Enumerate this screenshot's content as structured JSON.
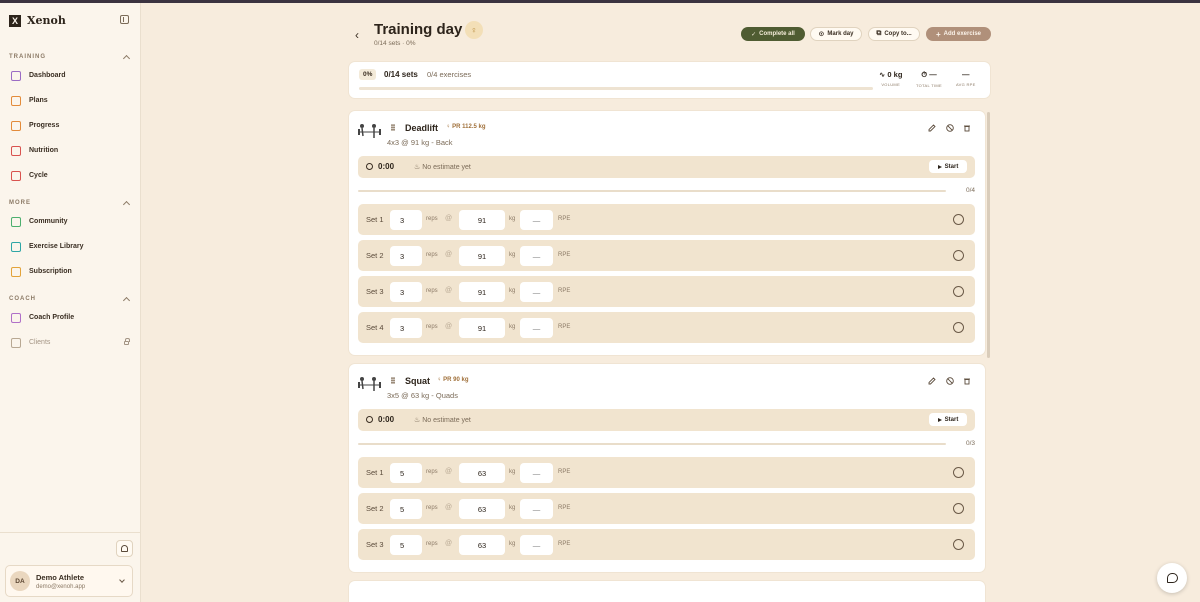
{
  "app": {
    "name": "Xenoh",
    "logo_letter": "X"
  },
  "sidebar": {
    "sections": [
      {
        "title": "TRAINING",
        "items": [
          {
            "label": "Dashboard",
            "icon": "dashboard-icon",
            "color": "#9b6cc4"
          },
          {
            "label": "Plans",
            "icon": "clipboard-icon",
            "color": "#e38b3a"
          },
          {
            "label": "Progress",
            "icon": "trending-up-icon",
            "color": "#e38b3a"
          },
          {
            "label": "Nutrition",
            "icon": "utensils-icon",
            "color": "#d9534f"
          },
          {
            "label": "Cycle",
            "icon": "calendar-icon",
            "color": "#d9534f"
          }
        ]
      },
      {
        "title": "MORE",
        "items": [
          {
            "label": "Community",
            "icon": "users-icon",
            "color": "#4caf6e"
          },
          {
            "label": "Exercise Library",
            "icon": "book-icon",
            "color": "#2ea6a6"
          },
          {
            "label": "Subscription",
            "icon": "card-icon",
            "color": "#e3a33a"
          }
        ]
      },
      {
        "title": "COACH",
        "items": [
          {
            "label": "Coach Profile",
            "icon": "user-icon",
            "color": "#b070c8"
          },
          {
            "label": "Clients",
            "icon": "user-plus-icon",
            "color": "#b8a893",
            "locked": true
          }
        ]
      }
    ],
    "user": {
      "initials": "DA",
      "name": "Demo Athlete",
      "email": "demo@xenoh.app"
    }
  },
  "header": {
    "title": "Training day",
    "subtitle": "0/14 sets · 0%",
    "buttons": {
      "complete_all": "Complete all",
      "mark_day": "Mark day",
      "copy_to": "Copy to...",
      "add_exercise": "Add exercise"
    }
  },
  "summary": {
    "percent": "0%",
    "sets": "0/14 sets",
    "exercises": "0/4 exercises",
    "progress": 0,
    "volume": {
      "value": "0 kg",
      "label": "VOLUME"
    },
    "total_time": {
      "value": "—",
      "label": "TOTAL TIME"
    },
    "avg_rpe": {
      "value": "—",
      "label": "AVG RPE"
    }
  },
  "labels": {
    "reps": "reps",
    "kg": "kg",
    "rpe": "RPE",
    "at": "@",
    "start": "Start",
    "rpe_placeholder": "—"
  },
  "exercises": [
    {
      "name": "Deadlift",
      "pr": "PR 112.5 kg",
      "meta": "4x3 @ 91 kg - Back",
      "timer": "0:00",
      "estimate": "No estimate yet",
      "progress_text": "0/4",
      "progress": 0,
      "sets": [
        {
          "label": "Set 1",
          "reps": "3",
          "weight": "91"
        },
        {
          "label": "Set 2",
          "reps": "3",
          "weight": "91"
        },
        {
          "label": "Set 3",
          "reps": "3",
          "weight": "91"
        },
        {
          "label": "Set 4",
          "reps": "3",
          "weight": "91"
        }
      ]
    },
    {
      "name": "Squat",
      "pr": "PR 90 kg",
      "meta": "3x5 @ 63 kg - Quads",
      "timer": "0:00",
      "estimate": "No estimate yet",
      "progress_text": "0/3",
      "progress": 0,
      "sets": [
        {
          "label": "Set 1",
          "reps": "5",
          "weight": "63"
        },
        {
          "label": "Set 2",
          "reps": "5",
          "weight": "63"
        },
        {
          "label": "Set 3",
          "reps": "5",
          "weight": "63"
        }
      ]
    }
  ]
}
